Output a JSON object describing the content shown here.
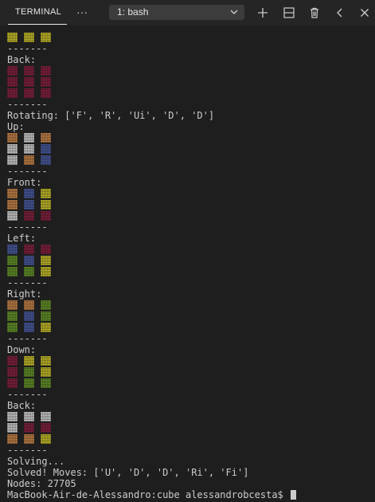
{
  "panel": {
    "tab_label": "TERMINAL",
    "more_label": "···",
    "terminal_select": "1: bash",
    "icons": [
      "plus-icon",
      "split-icon",
      "trash-icon",
      "chevron-left-icon",
      "close-icon"
    ]
  },
  "colors": {
    "W": "#d9d9d9",
    "Y": "#cfc62e",
    "R": "#8a2543",
    "B": "#4e5fa6",
    "G": "#6a9a2c",
    "O": "#cf8a4d"
  },
  "terminal": [
    {
      "cube": "YYY"
    },
    {
      "text": "-------"
    },
    {
      "text": "Back:"
    },
    {
      "cube": "RRR"
    },
    {
      "cube": "RRR"
    },
    {
      "cube": "RRR"
    },
    {
      "text": "-------"
    },
    {
      "text": "Rotating: ['F', 'R', 'Ui', 'D', 'D']"
    },
    {
      "text": "Up:"
    },
    {
      "cube": "OWO"
    },
    {
      "cube": "WWB"
    },
    {
      "cube": "WOB"
    },
    {
      "text": "-------"
    },
    {
      "text": "Front:"
    },
    {
      "cube": "OBY"
    },
    {
      "cube": "OBY"
    },
    {
      "cube": "WRR"
    },
    {
      "text": "-------"
    },
    {
      "text": "Left:"
    },
    {
      "cube": "BRR"
    },
    {
      "cube": "GBY"
    },
    {
      "cube": "GGY"
    },
    {
      "text": "-------"
    },
    {
      "text": "Right:"
    },
    {
      "cube": "OOG"
    },
    {
      "cube": "GBG"
    },
    {
      "cube": "GBY"
    },
    {
      "text": "-------"
    },
    {
      "text": "Down:"
    },
    {
      "cube": "RYY"
    },
    {
      "cube": "RGY"
    },
    {
      "cube": "RGG"
    },
    {
      "text": "-------"
    },
    {
      "text": "Back:"
    },
    {
      "cube": "WWW"
    },
    {
      "cube": "WRR"
    },
    {
      "cube": "OOY"
    },
    {
      "text": "-------"
    },
    {
      "text": "Solving..."
    },
    {
      "text": "Solved! Moves: ['U', 'D', 'D', 'Ri', 'Fi']"
    },
    {
      "text": "Nodes: 27705"
    },
    {
      "text": "MacBook-Air-de-Alessandro:cube alessandrobcesta$ ",
      "cursor": true
    }
  ]
}
